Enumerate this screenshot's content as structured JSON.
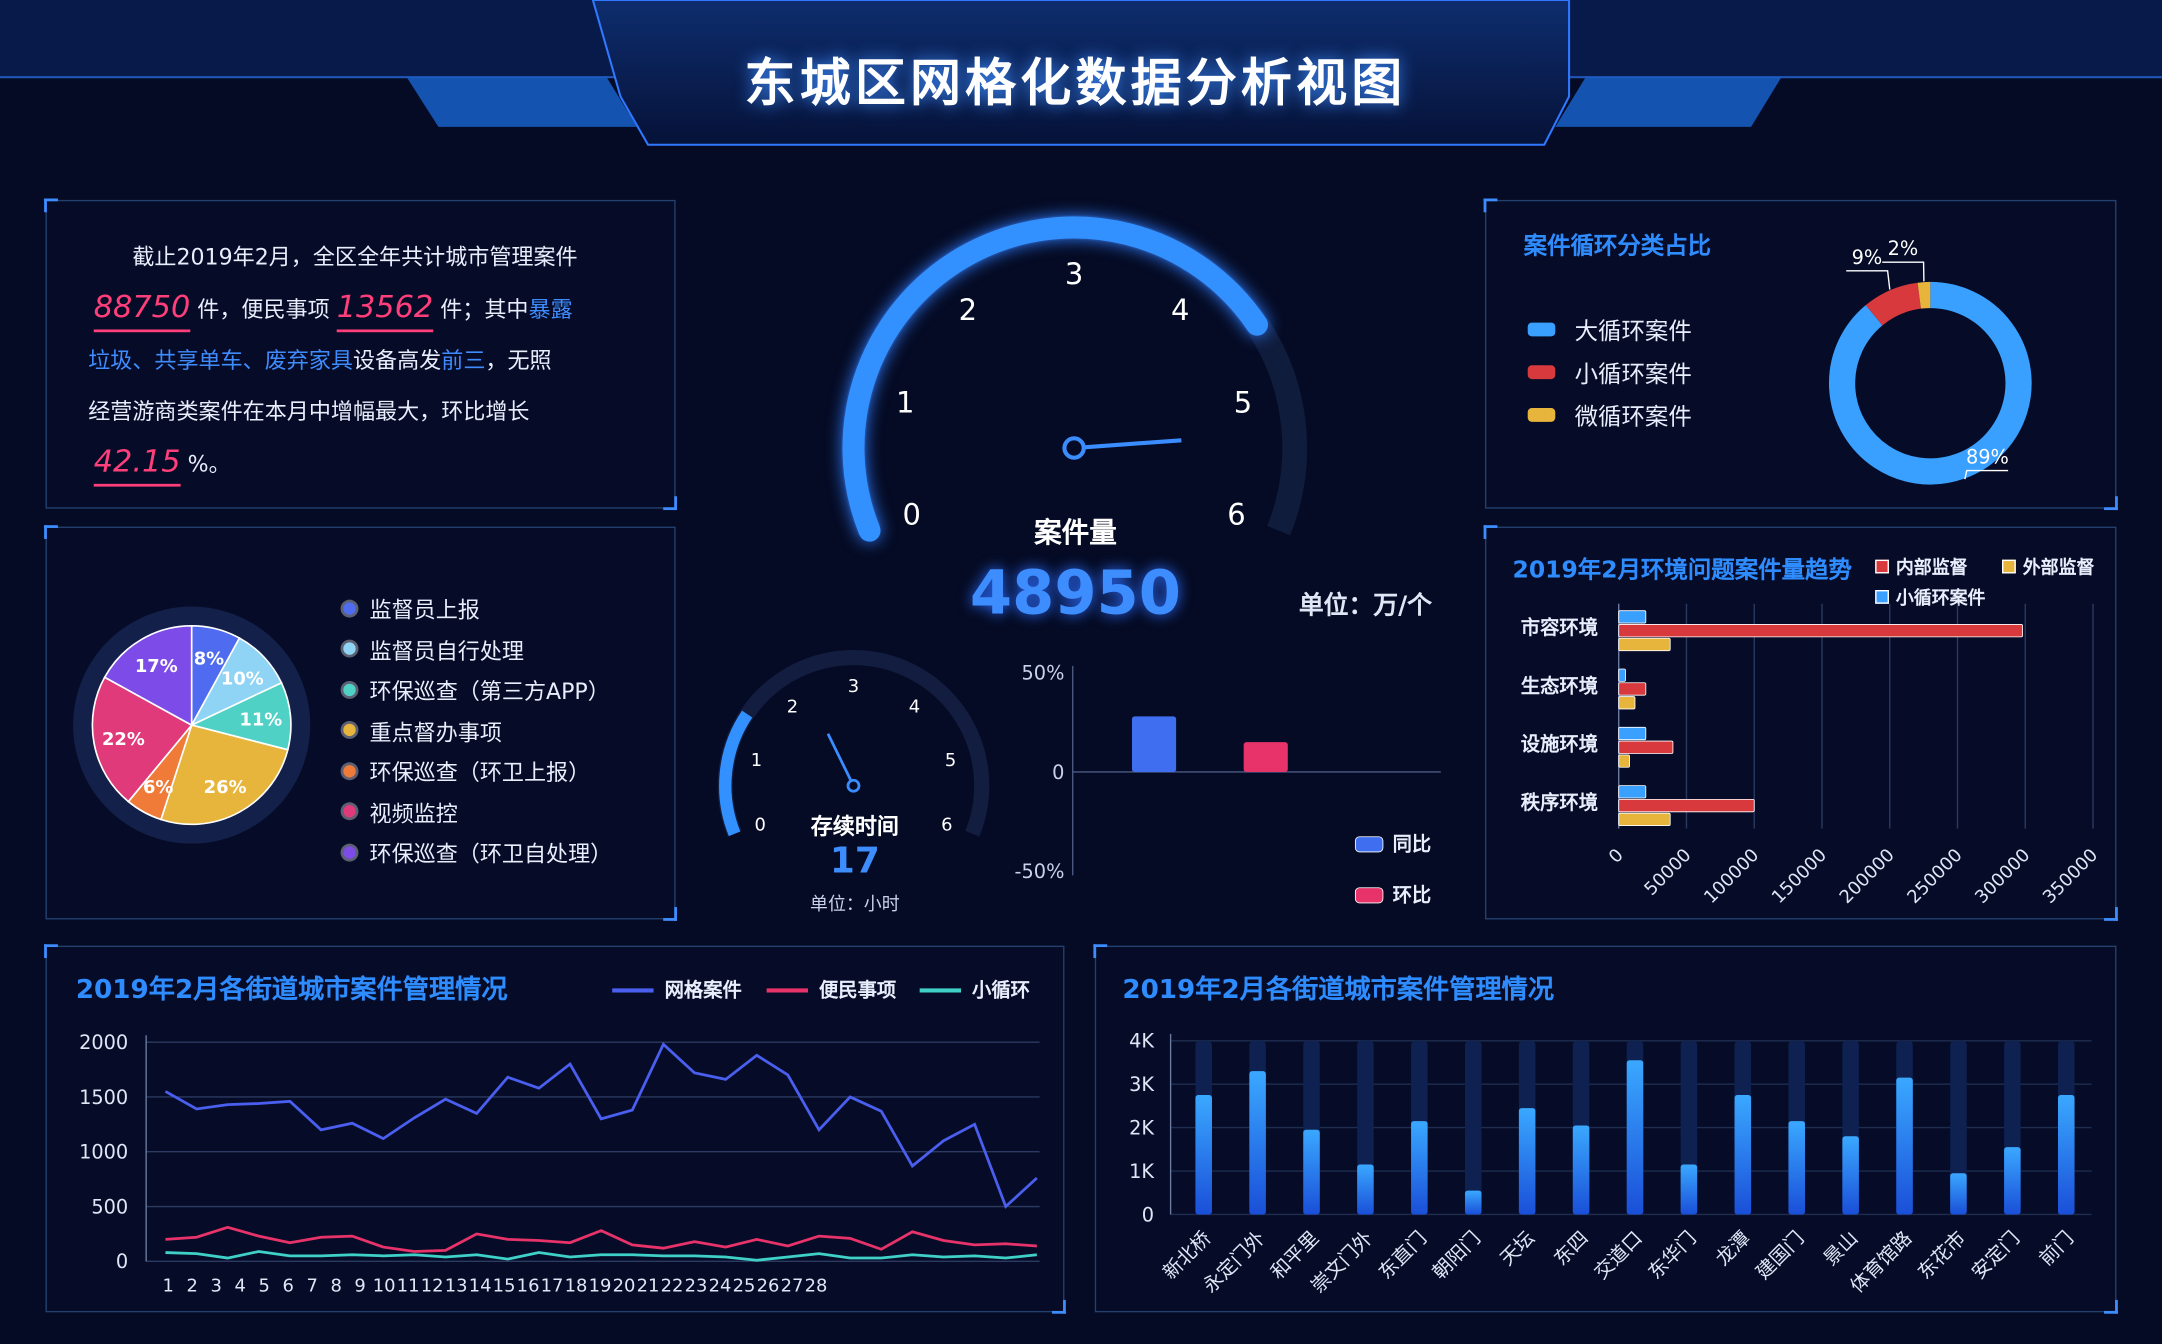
{
  "header": {
    "title": "东城区网格化数据分析视图"
  },
  "summary": {
    "line1": "截止2019年2月，全区全年共计城市管理案件",
    "num1": "88750",
    "txt2": "件，便民事项",
    "num2": "13562",
    "txt3": "件；其中",
    "hl1": "暴露",
    "hl2": "垃圾、共享单车、废弃家具",
    "txt4": "设备高发",
    "hl3": "前三",
    "txt5": "，无照",
    "line4": "经营游商类案件在本月中增幅最大，环比增长",
    "num3": "42.15",
    "txt6": "%。"
  },
  "pie": {
    "legend": [
      "监督员上报",
      "监督员自行处理",
      "环保巡查（第三方APP）",
      "重点督办事项",
      "环保巡查（环卫上报）",
      "视频监控",
      "环保巡查（环卫自处理）"
    ],
    "colors": [
      "#4f6cf0",
      "#8fd3f5",
      "#4fd1c5",
      "#e8b53c",
      "#f07a37",
      "#e03a7a",
      "#7d4ce8"
    ],
    "labels": [
      "8%",
      "10%",
      "11%",
      "26%",
      "6%",
      "22%",
      "17%"
    ]
  },
  "gauge": {
    "ticks": [
      "0",
      "1",
      "2",
      "3",
      "4",
      "5",
      "6"
    ],
    "title": "案件量",
    "value": "48950",
    "unit": "单位：万/个"
  },
  "small_gauge": {
    "ticks": [
      "0",
      "1",
      "2",
      "3",
      "4",
      "5",
      "6"
    ],
    "title": "存续时间",
    "value": "17",
    "unit": "单位：小时"
  },
  "yoy_chart": {
    "yticks": [
      "50%",
      "0",
      "-50%"
    ],
    "legend": [
      "同比",
      "环比"
    ],
    "colors": [
      "#3f6ff0",
      "#e8336a"
    ],
    "values": [
      28,
      15
    ]
  },
  "donut": {
    "title": "案件循环分类占比",
    "legend": [
      "大循环案件",
      "小循环案件",
      "微循环案件"
    ],
    "colors": [
      "#3aa0ff",
      "#d8393c",
      "#e8b53c"
    ],
    "labels": [
      "89%",
      "9%",
      "2%"
    ],
    "values": [
      89,
      9,
      2
    ]
  },
  "hbar": {
    "title": "2019年2月环境问题案件量趋势",
    "legend": [
      "内部监督",
      "外部监督",
      "小循环案件"
    ],
    "colors": [
      "#d8393c",
      "#e8b53c",
      "#3aa0ff"
    ],
    "categories": [
      "市容环境",
      "生态环境",
      "设施环境",
      "秩序环境"
    ],
    "xticks": [
      "0",
      "50000",
      "100000",
      "150000",
      "200000",
      "250000",
      "300000",
      "350000"
    ]
  },
  "line_panel": {
    "title": "2019年2月各街道城市案件管理情况",
    "legend": [
      "网格案件",
      "便民事项",
      "小循环"
    ],
    "colors": [
      "#4a5ff0",
      "#e8336a",
      "#3fd1c8"
    ],
    "yticks": [
      "2000",
      "1500",
      "1000",
      "500",
      "0"
    ],
    "xticks": [
      "1",
      "2",
      "3",
      "4",
      "5",
      "6",
      "7",
      "8",
      "9",
      "10",
      "11",
      "12",
      "13",
      "14",
      "15",
      "16",
      "17",
      "18",
      "19",
      "20",
      "21",
      "22",
      "23",
      "24",
      "25",
      "26",
      "27",
      "28"
    ]
  },
  "bar_panel": {
    "title": "2019年2月各街道城市案件管理情况",
    "yticks": [
      "4K",
      "3K",
      "2K",
      "1K",
      "0"
    ],
    "categories": [
      "新北桥",
      "永定门外",
      "和平里",
      "崇文门外",
      "东直门",
      "朝阳门",
      "天坛",
      "东四",
      "交道口",
      "东华门",
      "龙潭",
      "建国门",
      "景山",
      "体育馆路",
      "东花市",
      "安定门",
      "前门"
    ]
  },
  "chart_data": [
    {
      "type": "pie",
      "categories": [
        "监督员上报",
        "监督员自行处理",
        "环保巡查（第三方APP）",
        "重点督办事项",
        "环保巡查（环卫上报）",
        "视频监控",
        "环保巡查（环卫自处理）"
      ],
      "values": [
        8,
        10,
        11,
        26,
        6,
        22,
        17
      ]
    },
    {
      "type": "pie",
      "title": "案件循环分类占比",
      "categories": [
        "大循环案件",
        "小循环案件",
        "微循环案件"
      ],
      "values": [
        89,
        9,
        2
      ]
    },
    {
      "type": "bar",
      "categories": [
        "同比",
        "环比"
      ],
      "values": [
        28,
        15
      ],
      "ylim": [
        -50,
        50
      ]
    },
    {
      "type": "bar",
      "orientation": "horizontal",
      "title": "2019年2月环境问题案件量趋势",
      "categories": [
        "市容环境",
        "生态环境",
        "设施环境",
        "秩序环境"
      ],
      "series": [
        {
          "name": "小循环案件",
          "values": [
            20000,
            5000,
            20000,
            20000
          ]
        },
        {
          "name": "内部监督",
          "values": [
            298000,
            20000,
            40000,
            100000
          ]
        },
        {
          "name": "外部监督",
          "values": [
            38000,
            12000,
            8000,
            38000
          ]
        }
      ],
      "xlim": [
        0,
        350000
      ]
    },
    {
      "type": "line",
      "title": "2019年2月各街道城市案件管理情况",
      "x": [
        1,
        2,
        3,
        4,
        5,
        6,
        7,
        8,
        9,
        10,
        11,
        12,
        13,
        14,
        15,
        16,
        17,
        18,
        19,
        20,
        21,
        22,
        23,
        24,
        25,
        26,
        27,
        28
      ],
      "series": [
        {
          "name": "网格案件",
          "values": [
            1550,
            1390,
            1430,
            1440,
            1460,
            1200,
            1260,
            1120,
            1310,
            1480,
            1350,
            1680,
            1580,
            1800,
            1300,
            1380,
            1980,
            1720,
            1660,
            1880,
            1700,
            1200,
            1500,
            1370,
            870,
            1100,
            1250,
            500,
            760
          ]
        },
        {
          "name": "便民事项",
          "values": [
            200,
            220,
            310,
            230,
            170,
            220,
            230,
            130,
            90,
            100,
            250,
            200,
            190,
            170,
            280,
            150,
            120,
            180,
            130,
            200,
            140,
            230,
            210,
            110,
            270,
            190,
            150,
            160,
            140
          ]
        },
        {
          "name": "小循环",
          "values": [
            80,
            70,
            30,
            90,
            50,
            50,
            60,
            50,
            60,
            40,
            60,
            20,
            80,
            40,
            60,
            60,
            50,
            50,
            40,
            10,
            40,
            70,
            30,
            30,
            60,
            40,
            50,
            30,
            60
          ]
        }
      ],
      "ylim": [
        0,
        2000
      ]
    },
    {
      "type": "bar",
      "title": "2019年2月各街道城市案件管理情况",
      "categories": [
        "新北桥",
        "永定门外",
        "和平里",
        "崇文门外",
        "东直门",
        "朝阳门",
        "天坛",
        "东四",
        "交道口",
        "东华门",
        "龙潭",
        "建国门",
        "景山",
        "体育馆路",
        "东花市",
        "安定门",
        "前门"
      ],
      "values": [
        2750,
        3300,
        1950,
        1150,
        2150,
        550,
        2450,
        2050,
        3550,
        1150,
        2750,
        2150,
        1800,
        3150,
        950,
        1550,
        2750
      ],
      "ylim": [
        0,
        4000
      ]
    }
  ]
}
